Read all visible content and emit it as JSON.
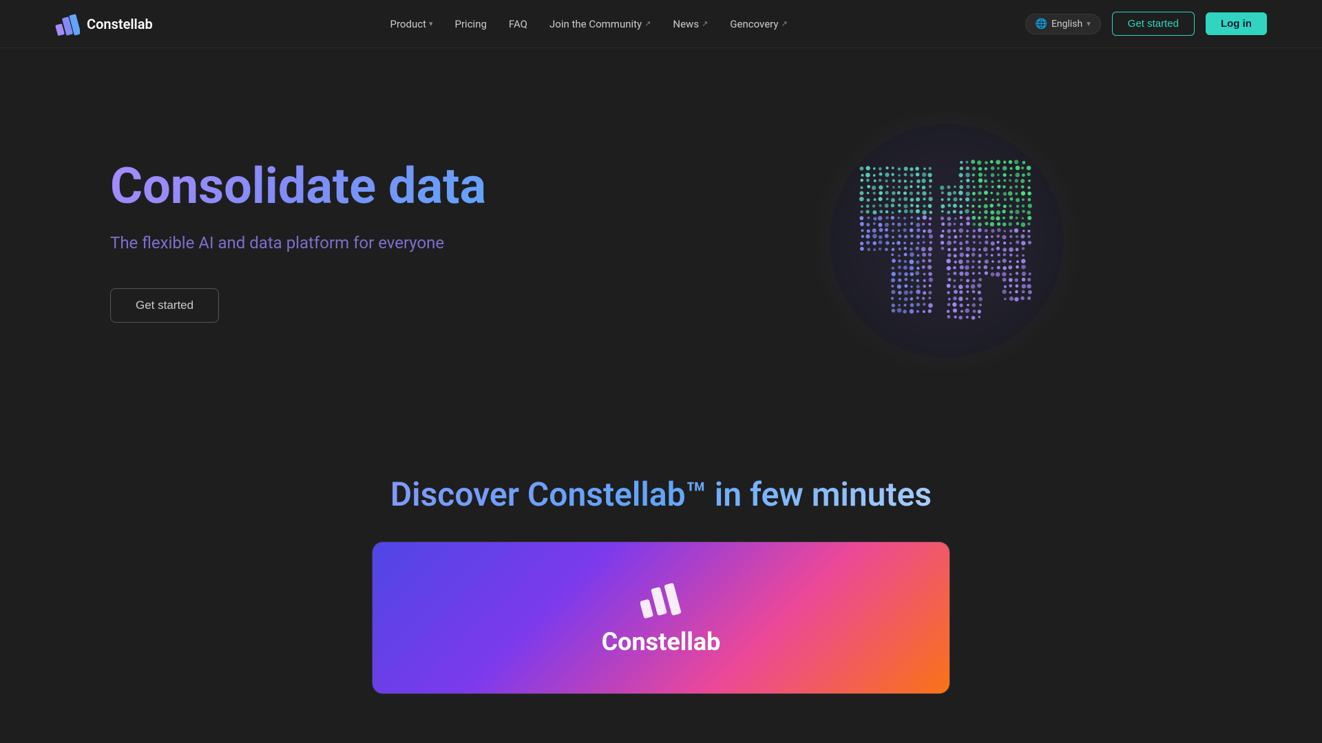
{
  "brand": {
    "name": "Constellab",
    "logo_alt": "Constellab logo"
  },
  "nav": {
    "links": [
      {
        "id": "product",
        "label": "Product",
        "has_dropdown": true,
        "external": false
      },
      {
        "id": "pricing",
        "label": "Pricing",
        "has_dropdown": false,
        "external": false
      },
      {
        "id": "faq",
        "label": "FAQ",
        "has_dropdown": false,
        "external": false
      },
      {
        "id": "community",
        "label": "Join the Community",
        "has_dropdown": false,
        "external": true
      },
      {
        "id": "news",
        "label": "News",
        "has_dropdown": false,
        "external": true
      },
      {
        "id": "gencovery",
        "label": "Gencovery",
        "has_dropdown": false,
        "external": true
      }
    ],
    "language": {
      "label": "English",
      "icon": "globe"
    },
    "cta_primary": "Get started",
    "cta_secondary": "Log in"
  },
  "hero": {
    "title": "Consolidate data",
    "subtitle": "The flexible AI and data platform for everyone",
    "cta_label": "Get started"
  },
  "discover": {
    "title": "Discover Constellab™ in few minutes"
  },
  "globe": {
    "gradient_colors": [
      "#a78bfa",
      "#60a5fa",
      "#30d4c0"
    ]
  }
}
